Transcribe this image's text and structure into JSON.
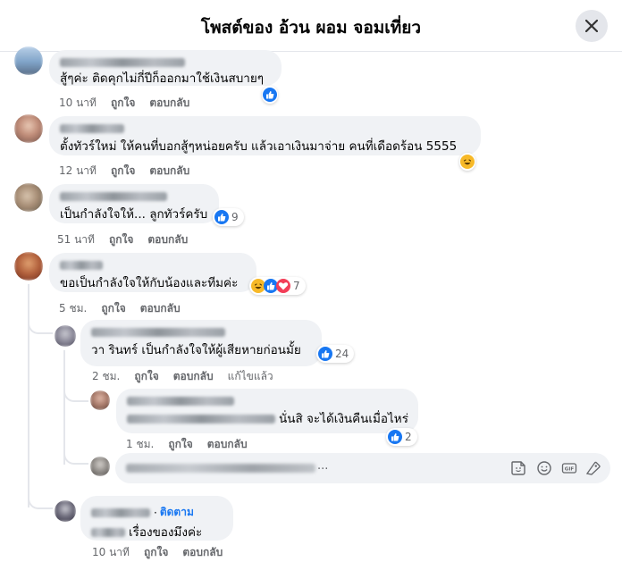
{
  "header": {
    "title": "โพสต์ของ อ้วน ผอม จอมเที่ยว"
  },
  "comments": {
    "c1": {
      "text": "สู้ๆค่ะ ติดคุกไม่กี่ปีก็ออกมาใช้เงินสบายๆ",
      "time": "10 นาที",
      "like": "ถูกใจ",
      "reply": "ตอบกลับ"
    },
    "c2": {
      "text": "ตั้งทัวร์ใหม่ ให้คนที่บอกสู้ๆหน่อยครับ แล้วเอาเงินมาจ่าย คนที่เดือดร้อน 5555",
      "time": "12 นาที",
      "like": "ถูกใจ",
      "reply": "ตอบกลับ"
    },
    "c3": {
      "text": "เป็นกำลังใจให้... ลูกทัวร์ครับ",
      "count": "9",
      "time": "51 นาที",
      "like": "ถูกใจ",
      "reply": "ตอบกลับ"
    },
    "c4": {
      "text": "ขอเป็นกำลังใจให้กับน้องและทีมค่ะ",
      "count": "7",
      "time": "5 ชม.",
      "like": "ถูกใจ",
      "reply": "ตอบกลับ"
    },
    "r1": {
      "text": "วา รินทร์ เป็นกำลังใจให้ผู้เสียหายก่อนมั้ย",
      "count": "24",
      "time": "2 ชม.",
      "like": "ถูกใจ",
      "reply": "ตอบกลับ",
      "edited": "แก้ไขแล้ว"
    },
    "r2": {
      "text": "นั่นสิ จะได้เงินคืนเมื่อไหร่",
      "count": "2",
      "time": "1 ชม.",
      "like": "ถูกใจ",
      "reply": "ตอบกลับ"
    },
    "r3": {
      "follow": "ติดตาม",
      "text": "เรื่องของมึงค่ะ",
      "time": "10 นาที",
      "like": "ถูกใจ",
      "reply": "ตอบกลับ"
    }
  },
  "reply_box": {
    "ellipsis": "..."
  },
  "icons": {
    "close": "close-icon",
    "like": "like-icon",
    "haha": "haha-icon",
    "care": "care-icon",
    "sticker": "sticker-icon",
    "emoji": "emoji-icon",
    "gif": "gif-icon",
    "camera": "camera-icon"
  },
  "colors": {
    "accent": "#1877f2",
    "meta": "#65676b",
    "bubble": "#f0f2f5"
  }
}
